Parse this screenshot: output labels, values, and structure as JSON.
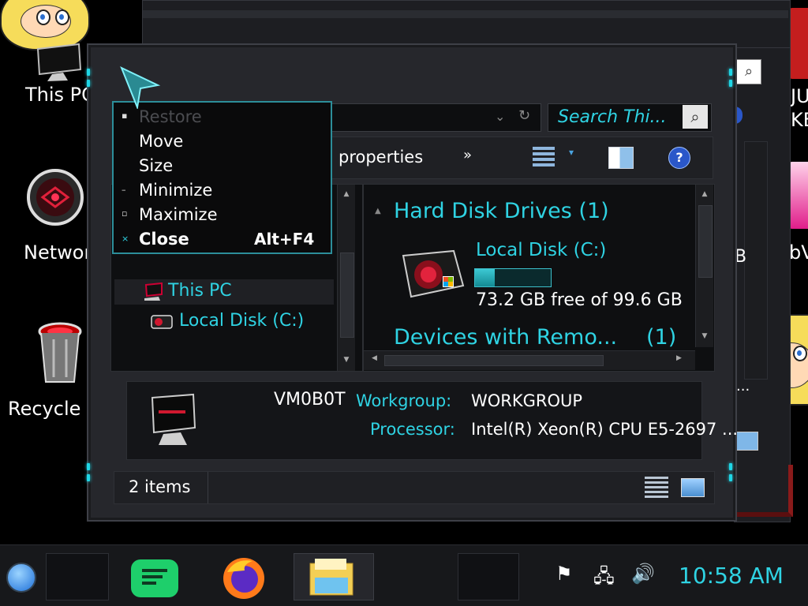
{
  "desktop": {
    "icons": [
      {
        "label": "This PC"
      },
      {
        "label": "Network"
      },
      {
        "label": "Recycle Bin"
      }
    ],
    "right_fragments": [
      "JU",
      "KE",
      "bV"
    ]
  },
  "back_window": {
    "fragment_b": "B",
    "fragment_dots": "..."
  },
  "explorer": {
    "address": "",
    "search_placeholder": "Search Thi...",
    "ribbon_text": "n properties",
    "ribbon_more": "»",
    "nav": {
      "this_pc": "This PC",
      "local_disk": "Local Disk (C:)"
    },
    "content": {
      "group_hdd": "Hard Disk Drives (1)",
      "drive_name": "Local Disk (C:)",
      "drive_usage_fraction": 0.265,
      "drive_free_text": "73.2 GB free of 99.6 GB",
      "group_removable": "Devices with Remo...",
      "group_removable_count": "(1)"
    },
    "details": {
      "computer_name": "VM0B0T",
      "workgroup_label": "Workgroup:",
      "workgroup_value": "WORKGROUP",
      "processor_label": "Processor:",
      "processor_value": "Intel(R) Xeon(R) CPU E5-2697 ..."
    },
    "status": {
      "items_count": "2 items"
    }
  },
  "context_menu": {
    "items": [
      {
        "label": "Restore",
        "disabled": true,
        "shortcut": ""
      },
      {
        "label": "Move",
        "disabled": false,
        "shortcut": ""
      },
      {
        "label": "Size",
        "disabled": false,
        "shortcut": ""
      },
      {
        "label": "Minimize",
        "disabled": false,
        "shortcut": ""
      },
      {
        "label": "Maximize",
        "disabled": false,
        "shortcut": ""
      },
      {
        "label": "Close",
        "disabled": false,
        "shortcut": "Alt+F4"
      }
    ]
  },
  "taskbar": {
    "clock": "10:58 AM"
  },
  "colors": {
    "accent_cyan": "#2fd3e3",
    "usage_bar": "#1fa7b0",
    "window_bg": "#26272c"
  }
}
